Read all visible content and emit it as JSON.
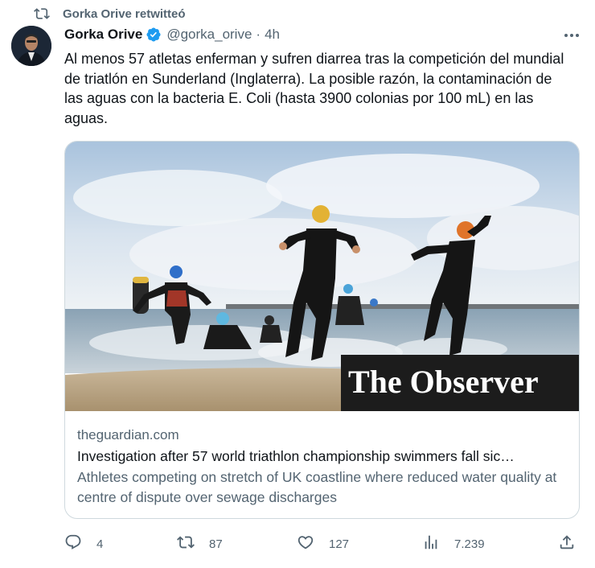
{
  "retweet_header": {
    "text": "Gorka Orive retwitteó",
    "icon": "retweet-icon"
  },
  "author": {
    "name": "Gorka Orive",
    "verified": true,
    "handle": "@gorka_orive",
    "separator": "·",
    "time": "4h",
    "verified_color": "#1d9bf0"
  },
  "tweet": {
    "text": "Al menos 57 atletas enferman y sufren diarrea tras la competición del mundial de triatlón en Sunderland (Inglaterra). La posible razón, la contaminación de las aguas con la bacteria E. Coli (hasta 3900 colonias por 100 mL) en las aguas."
  },
  "card": {
    "image_overlay_text": "The Observer",
    "domain": "theguardian.com",
    "title": "Investigation after 57 world triathlon championship swimmers fall sic…",
    "description": "Athletes competing on stretch of UK coastline where reduced water quality at centre of dispute over sewage discharges"
  },
  "actions": {
    "replies": "4",
    "retweets": "87",
    "likes": "127",
    "views": "7.239"
  },
  "colors": {
    "text_primary": "#0f1419",
    "text_secondary": "#536471",
    "border": "#cfd9de",
    "accent": "#1d9bf0"
  }
}
